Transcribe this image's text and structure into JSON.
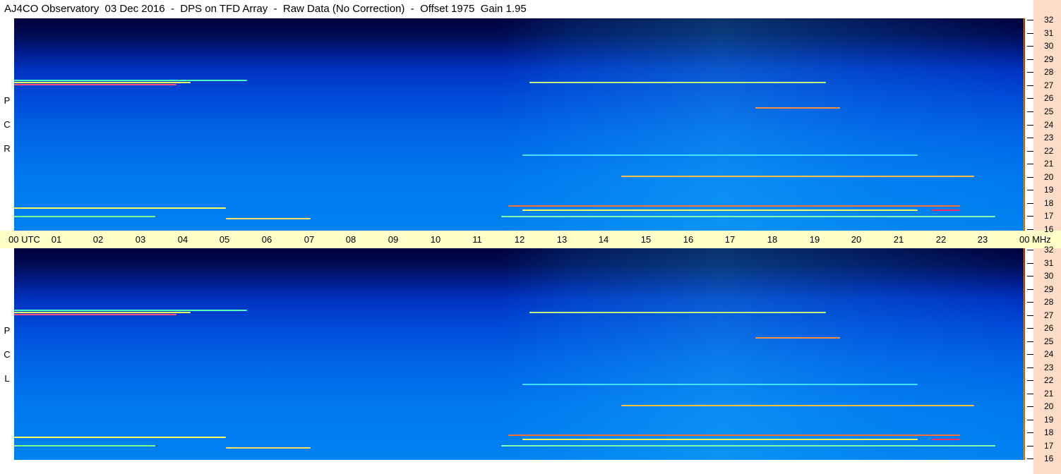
{
  "title": "AJ4CO Observatory  03 Dec 2016  -  DPS on TFD Array  -  Raw Data (No Correction)  -  Offset 1975  Gain 1.95",
  "panels": {
    "top": {
      "polarization_letters": [
        "P",
        "C",
        "R"
      ]
    },
    "bottom": {
      "polarization_letters": [
        "P",
        "C",
        "L"
      ]
    }
  },
  "frequency_labels": [
    "32",
    "31",
    "30",
    "29",
    "28",
    "27",
    "26",
    "25",
    "24",
    "23",
    "22",
    "21",
    "20",
    "19",
    "18",
    "17",
    "16"
  ],
  "time_labels": [
    "00  UTC",
    "01",
    "02",
    "03",
    "04",
    "05",
    "06",
    "07",
    "08",
    "09",
    "10",
    "11",
    "12",
    "13",
    "14",
    "15",
    "16",
    "17",
    "18",
    "19",
    "20",
    "21",
    "22",
    "23",
    "00 MHz"
  ],
  "colors": {
    "time_bar": "#ffffc8",
    "right_bar": "#ffdcc8"
  }
}
